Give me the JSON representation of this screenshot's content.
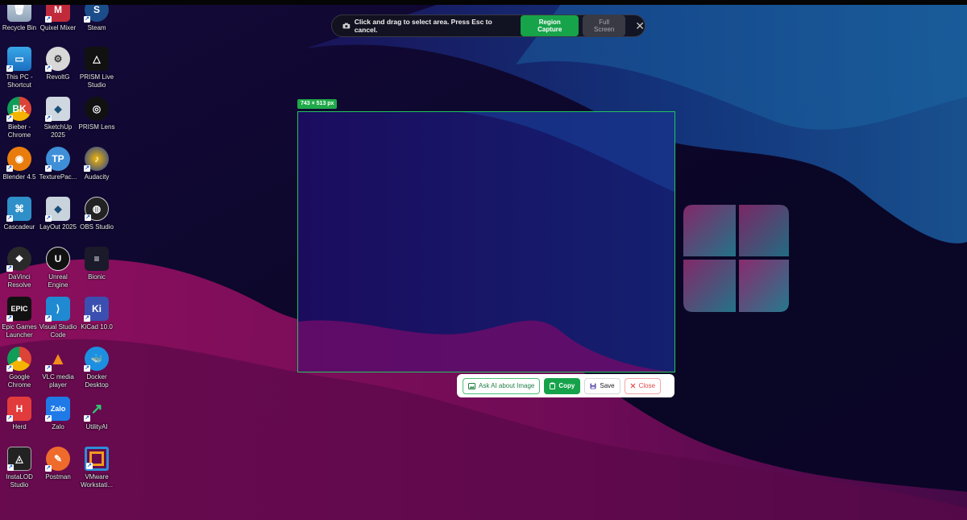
{
  "toolbar": {
    "instruction": "Click and drag to select area. Press Esc to cancel.",
    "region_label": "Region Capture",
    "fullscreen_label": "Full Screen",
    "close_glyph": "✕"
  },
  "selection": {
    "size_label": "743 × 513 px"
  },
  "actions": {
    "ask_ai": "Ask AI about Image",
    "copy": "Copy",
    "save": "Save",
    "close": "Close"
  },
  "desktop": {
    "icons": [
      {
        "label": "Recycle Bin"
      },
      {
        "label": "Quixel Mixer"
      },
      {
        "label": "Steam"
      },
      {
        "label": "This PC -\nShortcut"
      },
      {
        "label": "RevoltG"
      },
      {
        "label": "PRISM Live\nStudio"
      },
      {
        "label": "Bieber -\nChrome"
      },
      {
        "label": "SketchUp\n2025"
      },
      {
        "label": "PRISM Lens"
      },
      {
        "label": "Blender 4.5"
      },
      {
        "label": "TexturePac..."
      },
      {
        "label": "Audacity"
      },
      {
        "label": "Cascadeur"
      },
      {
        "label": "LayOut 2025"
      },
      {
        "label": "OBS Studio"
      },
      {
        "label": "DaVinci\nResolve"
      },
      {
        "label": "Unreal\nEngine"
      },
      {
        "label": "Bionic"
      },
      {
        "label": "Epic Games\nLauncher"
      },
      {
        "label": "Visual Studio\nCode"
      },
      {
        "label": "KiCad 10.0"
      },
      {
        "label": "Google\nChrome"
      },
      {
        "label": "VLC media\nplayer"
      },
      {
        "label": "Docker\nDesktop"
      },
      {
        "label": "Herd"
      },
      {
        "label": "Zalo"
      },
      {
        "label": "UtilityAI"
      },
      {
        "label": "InstaLOD\nStudio"
      },
      {
        "label": "Postman"
      },
      {
        "label": "VMware\nWorkstati..."
      }
    ]
  },
  "colors": {
    "accent_green": "#22c55e",
    "copy_green": "#15a24a",
    "close_red": "#e04848"
  }
}
